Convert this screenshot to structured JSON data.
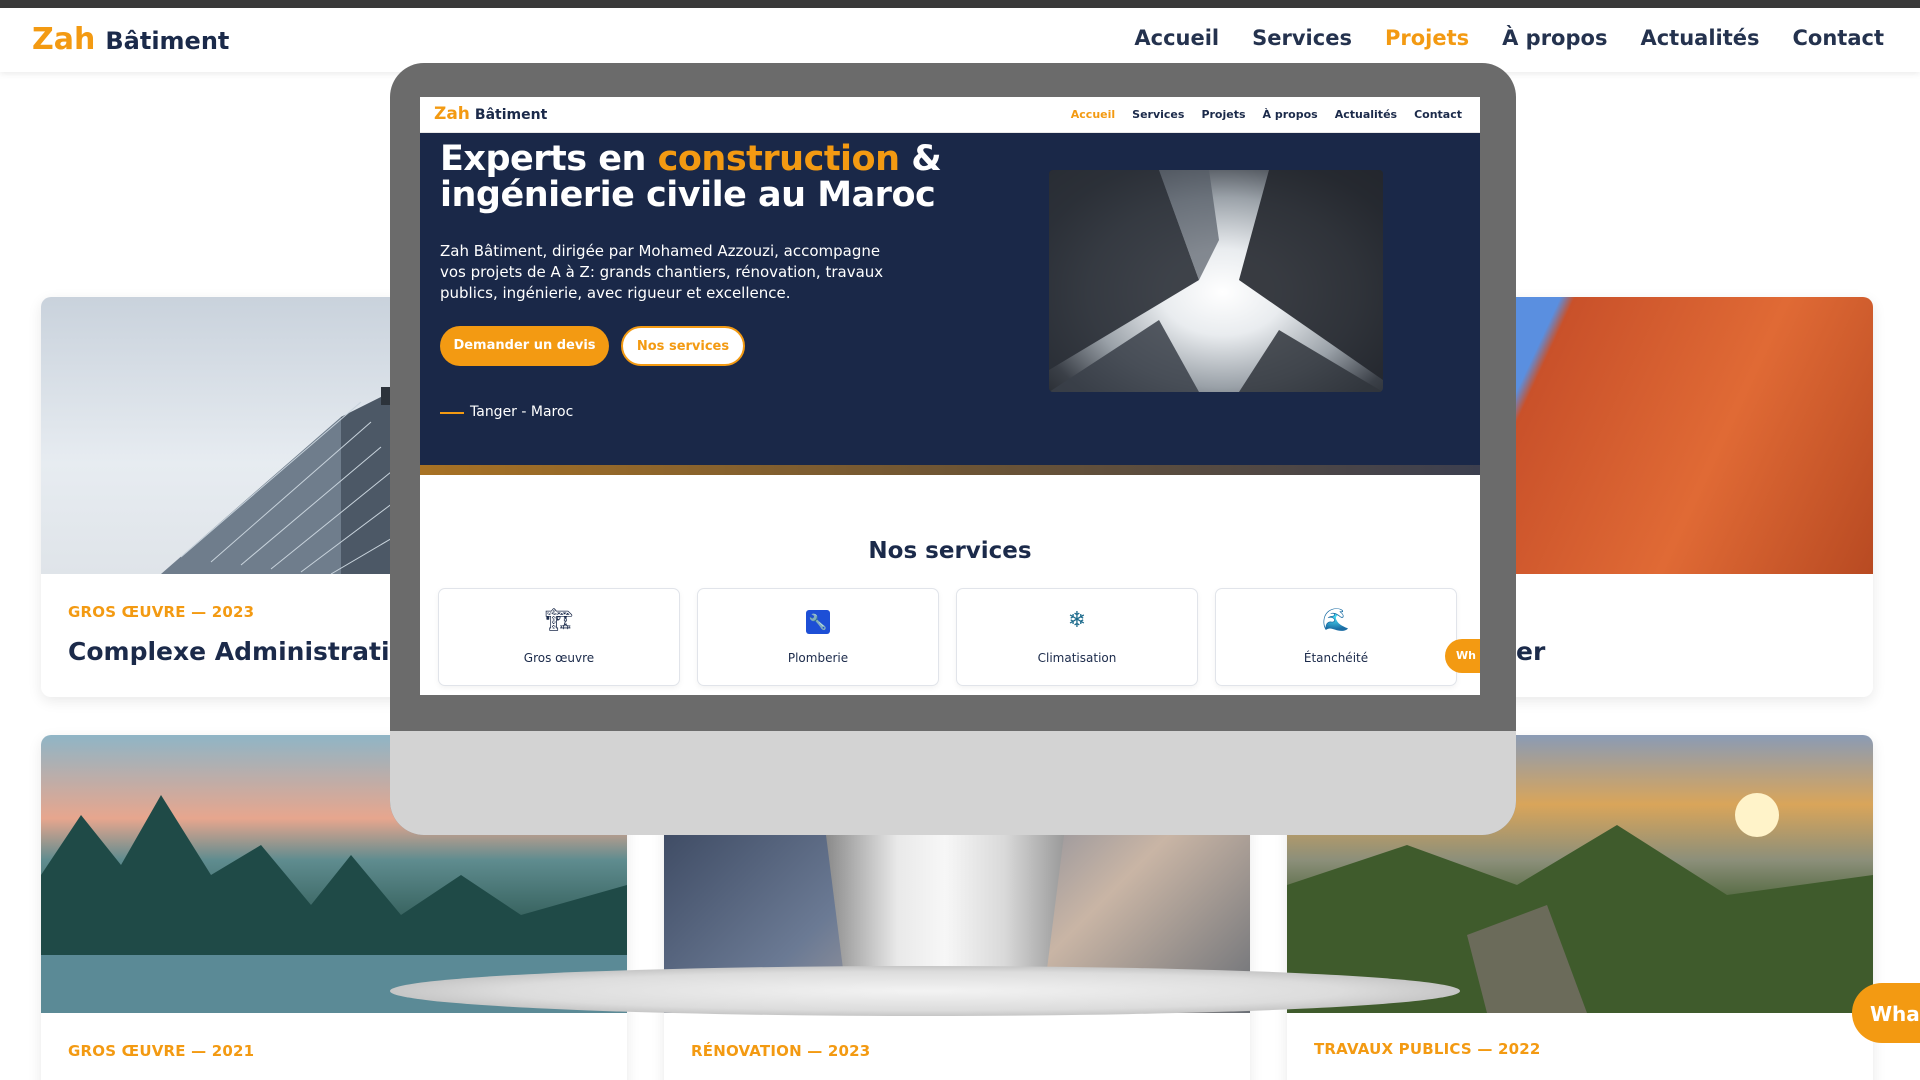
{
  "background_page": {
    "logo": {
      "brand": "Zah",
      "name": "Bâtiment"
    },
    "nav": [
      {
        "label": "Accueil"
      },
      {
        "label": "Services"
      },
      {
        "label": "Projets",
        "active": true
      },
      {
        "label": "À propos"
      },
      {
        "label": "Actualités"
      },
      {
        "label": "Contact"
      }
    ],
    "projects": [
      {
        "category": "GROS ŒUVRE — 2023",
        "title": "Complexe Administratif To"
      },
      {
        "category": "",
        "title": "er"
      },
      {
        "category": "GROS ŒUVRE — 2021",
        "title": ""
      },
      {
        "category": "RÉNOVATION — 2023",
        "title": ""
      },
      {
        "category": "TRAVAUX PUBLICS — 2022",
        "title": ""
      }
    ],
    "whatsapp_label": "Wha"
  },
  "monitor_site": {
    "logo": {
      "brand": "Zah",
      "name": "Bâtiment"
    },
    "nav": [
      {
        "label": "Accueil",
        "active": true
      },
      {
        "label": "Services"
      },
      {
        "label": "Projets"
      },
      {
        "label": "À propos"
      },
      {
        "label": "Actualités"
      },
      {
        "label": "Contact"
      }
    ],
    "hero": {
      "title_part1": "Experts en ",
      "title_highlight": "construction",
      "title_part2": " & ingénierie civile au Maroc",
      "lead": "Zah Bâtiment, dirigée par Mohamed Azzouzi, accompagne vos projets de A à Z: grands chantiers, rénovation, travaux publics, ingénierie, avec rigueur et excellence.",
      "cta_primary": "Demander un devis",
      "cta_secondary": "Nos services",
      "location": "Tanger - Maroc"
    },
    "services_title": "Nos services",
    "services": [
      {
        "label": "Gros œuvre",
        "icon": "crane-icon"
      },
      {
        "label": "Plomberie",
        "icon": "wrench-icon"
      },
      {
        "label": "Climatisation",
        "icon": "snowflake-icon"
      },
      {
        "label": "Étanchéité",
        "icon": "water-wave-icon"
      }
    ],
    "whatsapp_label": "Wh"
  },
  "colors": {
    "accent": "#f39a12",
    "navy": "#1a2848",
    "text": "#1b2a4a"
  }
}
